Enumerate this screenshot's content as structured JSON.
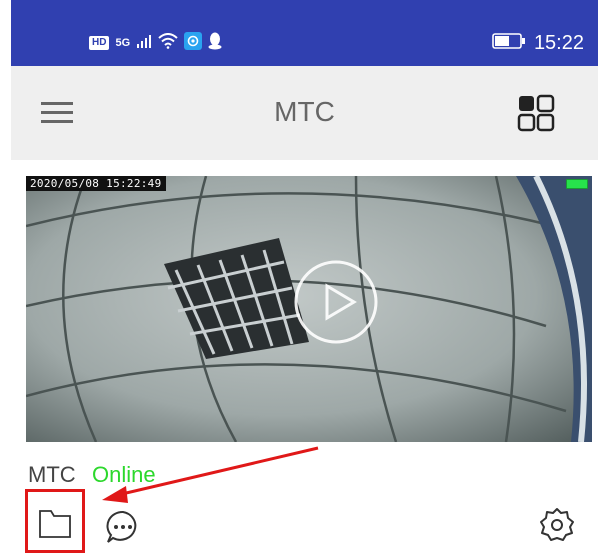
{
  "status_bar": {
    "hd_badge": "HD",
    "network_label": "5G",
    "icons": [
      "signal-icon",
      "wifi-icon",
      "app-notification-icon",
      "qq-icon",
      "battery-icon"
    ],
    "time": "15:22"
  },
  "app_bar": {
    "title": "MTC",
    "left_icon": "hamburger-menu-icon",
    "right_icon": "grid-view-icon"
  },
  "camera_card": {
    "timestamp": "2020/05/08 15:22:49",
    "play_icon": "play-icon",
    "battery_color": "#27e34c"
  },
  "device": {
    "name": "MTC",
    "status": "Online",
    "status_color": "#2cd82c"
  },
  "actions": {
    "icons": [
      "folder-icon",
      "chat-icon",
      "settings-icon"
    ],
    "highlight_color": "#e01818"
  },
  "colors": {
    "status_bar": "#3040b0",
    "app_bar": "#efefef"
  }
}
